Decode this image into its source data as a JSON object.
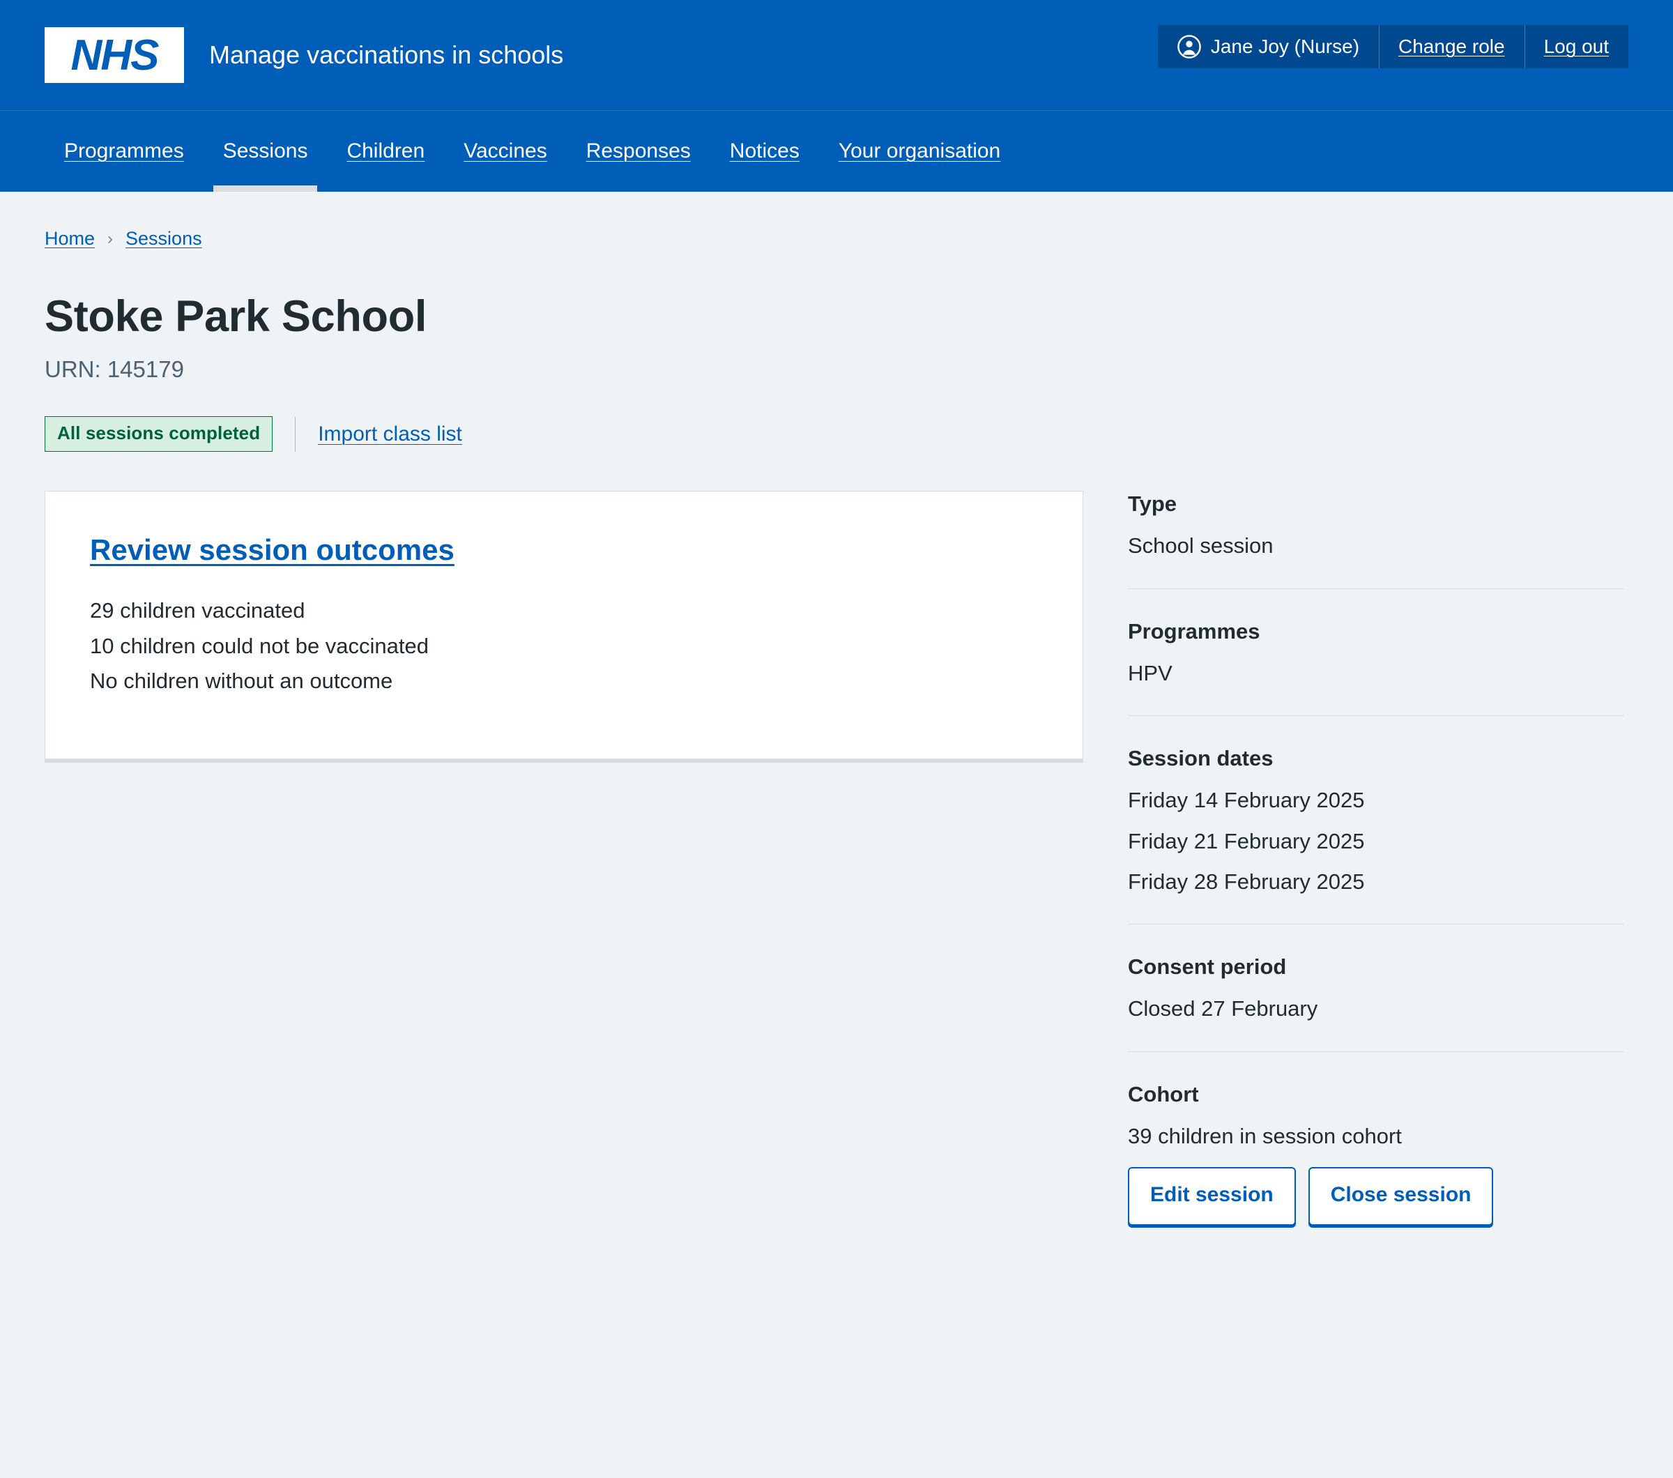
{
  "header": {
    "logo_alt": "NHS",
    "service_name": "Manage vaccinations in schools",
    "account": {
      "user_name": "Jane Joy (Nurse)",
      "change_role_label": "Change role",
      "log_out_label": "Log out"
    }
  },
  "nav": {
    "items": [
      {
        "label": "Programmes",
        "current": false
      },
      {
        "label": "Sessions",
        "current": true
      },
      {
        "label": "Children",
        "current": false
      },
      {
        "label": "Vaccines",
        "current": false
      },
      {
        "label": "Responses",
        "current": false
      },
      {
        "label": "Notices",
        "current": false
      },
      {
        "label": "Your organisation",
        "current": false
      }
    ]
  },
  "breadcrumb": {
    "items": [
      {
        "label": "Home"
      },
      {
        "label": "Sessions"
      }
    ],
    "separator": "›"
  },
  "page": {
    "title": "Stoke Park School",
    "subtitle": "URN: 145179",
    "status_tag": "All sessions completed",
    "import_link": "Import class list"
  },
  "card": {
    "heading": "Review session outcomes",
    "lines": [
      "29 children vaccinated",
      "10 children could not be vaccinated",
      "No children without an outcome"
    ]
  },
  "sidebar": {
    "type": {
      "title": "Type",
      "value": "School session"
    },
    "programmes": {
      "title": "Programmes",
      "value": "HPV"
    },
    "session_dates": {
      "title": "Session dates",
      "values": [
        "Friday 14 February 2025",
        "Friday 21 February 2025",
        "Friday 28 February 2025"
      ]
    },
    "consent_period": {
      "title": "Consent period",
      "value": "Closed 27 February"
    },
    "cohort": {
      "title": "Cohort",
      "value": "39 children in session cohort"
    },
    "actions": {
      "edit_label": "Edit session",
      "close_label": "Close session"
    }
  },
  "colors": {
    "nhs_blue": "#005eb8",
    "dark_blue": "#00488f",
    "page_background": "#eff3f5",
    "green_tag_bg": "#d7efe0",
    "green_tag_text": "#00603c",
    "text": "#212b32",
    "secondary_text": "#4c6272",
    "border": "#d8dde0"
  }
}
